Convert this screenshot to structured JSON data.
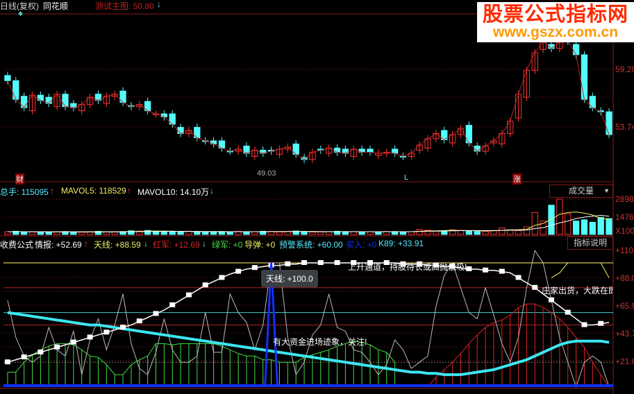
{
  "header": {
    "period_label": "日线(复权)",
    "app_name": "同花顺",
    "main_indicator": "测试主图: 50.80",
    "main_indicator_arrow": "↓"
  },
  "watermark": {
    "title": "股票公式指标网",
    "url": "www.gszx.com.cn"
  },
  "price_axis": [
    "59.29",
    "53.74"
  ],
  "price_annotations": {
    "low_label": "49.03",
    "finance_badge": "财",
    "limit_badge": "涨",
    "l_marker": "L"
  },
  "volume_header": {
    "total": "总手: 115095",
    "total_arrow": "↑",
    "mavol5": "MAVOL5: 118529",
    "mavol5_arrow": "↑",
    "mavol10": "MAVOL10: 14.10万",
    "mavol10_arrow": "↓",
    "selector": "成交量",
    "selector_arrow": "▼"
  },
  "volume_axis": [
    "2898",
    "1476",
    "X100"
  ],
  "indicator_header": {
    "name": "收费公式",
    "qingbao": "情报: +52.69",
    "qingbao_arrow": "↑",
    "tianxian": "天线: +88.59",
    "tianxian_arrow": "↓",
    "hongjun": "红军: +12.69",
    "hongjun_arrow": "↓",
    "lvjun": "绿军: +0",
    "daodan": "导弹: +0",
    "yujing": "预警系统: +60.00",
    "mairu": "买入: +0",
    "k89": "K89: +33.91",
    "help_button": "指标说明"
  },
  "indicator_axis": [
    "+110",
    "+88.0",
    "+65.9",
    "+43.7",
    "+21.6"
  ],
  "indicator_annotations": {
    "tooltip": "天线: +100.0",
    "uptrend": "上升通道，持股待长或高抛低吸!",
    "inflow": "有大资金进场迹象，关注!",
    "distribution": "庄家出货，大跌在即"
  },
  "colors": {
    "up": "#ff3333",
    "down": "#54fcfc",
    "grid": "#8b1a1a",
    "white_line": "#ffffff",
    "cyan_line": "#3ce6f0",
    "green_hist": "#44dd44",
    "red_hist": "#dd2222",
    "blue": "#1030ff",
    "yellow": "#f0f060"
  },
  "chart_data": {
    "type": "candlestick",
    "close": [
      58.2,
      56.4,
      55.6,
      56.8,
      56.3,
      56.0,
      56.9,
      55.7,
      55.6,
      55.9,
      56.6,
      56.3,
      56.7,
      56.9,
      56.1,
      55.7,
      55.9,
      55.3,
      55.0,
      54.7,
      54.0,
      53.1,
      53.4,
      52.7,
      52.4,
      52.1,
      51.7,
      51.4,
      51.6,
      51.2,
      51.5,
      51.2,
      51.4,
      51.6,
      51.8,
      51.1,
      50.6,
      51.3,
      51.5,
      51.7,
      51.3,
      51.2,
      51.6,
      51.3,
      51.3,
      51.2,
      51.3,
      51.2,
      50.9,
      51.2,
      52.0,
      52.6,
      53.1,
      52.5,
      53.0,
      53.6,
      52.2,
      51.4,
      51.9,
      52.4,
      53.1,
      54.3,
      56.9,
      59.2,
      60.9,
      62.0,
      61.3,
      61.9,
      62.0,
      60.7,
      56.4,
      55.6,
      55.2,
      53.0
    ],
    "volume": [
      230,
      260,
      190,
      200,
      210,
      180,
      220,
      240,
      200,
      190,
      230,
      260,
      210,
      200,
      240,
      300,
      280,
      330,
      270,
      250,
      230,
      210,
      260,
      230,
      210,
      220,
      240,
      200,
      260,
      230,
      220,
      260,
      250,
      210,
      240,
      280,
      230,
      190,
      200,
      220,
      260,
      240,
      230,
      210,
      220,
      200,
      250,
      240,
      200,
      230,
      420,
      350,
      280,
      300,
      380,
      340,
      290,
      240,
      250,
      330,
      540,
      380,
      320,
      620,
      1800,
      1100,
      2400,
      2898,
      1700,
      1100,
      1200,
      1000,
      1400,
      1300
    ],
    "mavol5": [
      230,
      230,
      230,
      230,
      220,
      210,
      210,
      210,
      210,
      210,
      215,
      220,
      220,
      220,
      230,
      240,
      250,
      270,
      280,
      280,
      270,
      250,
      240,
      235,
      230,
      225,
      220,
      220,
      225,
      230,
      230,
      235,
      235,
      235,
      240,
      245,
      245,
      240,
      230,
      225,
      225,
      230,
      235,
      230,
      225,
      220,
      225,
      230,
      230,
      230,
      260,
      290,
      300,
      320,
      340,
      330,
      320,
      300,
      290,
      300,
      350,
      380,
      390,
      420,
      740,
      900,
      1250,
      1650,
      1800,
      1840,
      1750,
      1600,
      1300,
      1250
    ],
    "mavol10": [
      230,
      230,
      230,
      230,
      225,
      220,
      220,
      220,
      220,
      215,
      215,
      215,
      215,
      215,
      220,
      225,
      230,
      240,
      245,
      250,
      255,
      255,
      255,
      250,
      245,
      240,
      235,
      230,
      228,
      228,
      228,
      230,
      232,
      234,
      236,
      238,
      240,
      238,
      235,
      232,
      230,
      230,
      230,
      230,
      230,
      228,
      228,
      230,
      230,
      230,
      245,
      260,
      270,
      285,
      300,
      315,
      320,
      320,
      320,
      320,
      335,
      345,
      350,
      360,
      480,
      560,
      750,
      950,
      1100,
      1300,
      1420,
      1500,
      1560,
      1500
    ],
    "indicator": {
      "qingbao": [
        20,
        22,
        24,
        26,
        28,
        30,
        32,
        34,
        36,
        38,
        40,
        42,
        44,
        46,
        48,
        50,
        53,
        56,
        59,
        62,
        66,
        70,
        74,
        78,
        82,
        85,
        88,
        91,
        93,
        95,
        96,
        97,
        98,
        98,
        99,
        99,
        100,
        100,
        100,
        100,
        100,
        100,
        100,
        100,
        100,
        100,
        100,
        100,
        99,
        99,
        99,
        98,
        98,
        97,
        97,
        96,
        95,
        95,
        94,
        94,
        93,
        92,
        88,
        84,
        80,
        75,
        70,
        65,
        60,
        55,
        50,
        50,
        51,
        52
      ],
      "k89": [
        60,
        59,
        58,
        57,
        56,
        55,
        54,
        53,
        52,
        51,
        50,
        50,
        49,
        48,
        47,
        46,
        45,
        44,
        43,
        42,
        41,
        40,
        39,
        38,
        37,
        36,
        35,
        34,
        33,
        32,
        31,
        30,
        29,
        28,
        27,
        26,
        25,
        24,
        23,
        22,
        21,
        20,
        19,
        18,
        17,
        16,
        15,
        14,
        13,
        12,
        12,
        11,
        11,
        10,
        10,
        10,
        11,
        12,
        13,
        14,
        16,
        18,
        20,
        22,
        25,
        28,
        31,
        34,
        36,
        37,
        37,
        37,
        37,
        36
      ],
      "gray": [
        70,
        40,
        25,
        20,
        25,
        48,
        30,
        25,
        45,
        10,
        38,
        55,
        30,
        50,
        75,
        35,
        15,
        10,
        28,
        55,
        30,
        20,
        20,
        25,
        60,
        28,
        28,
        75,
        60,
        52,
        30,
        50,
        100,
        100,
        40,
        10,
        20,
        42,
        50,
        75,
        48,
        45,
        30,
        28,
        20,
        10,
        18,
        38,
        30,
        15,
        20,
        25,
        65,
        90,
        100,
        80,
        60,
        55,
        80,
        58,
        35,
        20,
        40,
        80,
        110,
        100,
        70,
        40,
        20,
        0,
        20,
        25,
        20,
        0
      ],
      "green": [
        12,
        12,
        20,
        26,
        30,
        33,
        35,
        35,
        34,
        30,
        25,
        24,
        18,
        10,
        10,
        18,
        22,
        25,
        35,
        35,
        34,
        35,
        35,
        35,
        35,
        35,
        33,
        30,
        27,
        25,
        25,
        22,
        22,
        20,
        20,
        20,
        24,
        26,
        28,
        30,
        33,
        35,
        37,
        36,
        34,
        30,
        28,
        20,
        0,
        0,
        0,
        0,
        0,
        0,
        0,
        0,
        0,
        0,
        0,
        0,
        0,
        0,
        0,
        0,
        0,
        0,
        0,
        0,
        0,
        0,
        0,
        0,
        0,
        0
      ],
      "red": [
        0,
        0,
        0,
        0,
        0,
        0,
        0,
        0,
        0,
        0,
        0,
        0,
        0,
        0,
        0,
        0,
        0,
        0,
        0,
        0,
        0,
        0,
        0,
        0,
        0,
        0,
        0,
        0,
        0,
        0,
        0,
        0,
        0,
        0,
        0,
        0,
        0,
        0,
        0,
        0,
        0,
        0,
        0,
        0,
        0,
        0,
        0,
        0,
        0,
        0,
        0,
        0,
        8,
        14,
        20,
        27,
        35,
        42,
        48,
        52,
        54,
        58,
        64,
        67,
        67,
        64,
        60,
        55,
        48,
        40,
        32,
        20,
        10,
        0
      ],
      "yellow_start": 66,
      "yellow": [
        88,
        92,
        100,
        100,
        100,
        100,
        100,
        88
      ],
      "spike_index": 32,
      "spike_value": 100,
      "hlines": [
        {
          "v": 100,
          "c": "yellow"
        },
        {
          "v": 80,
          "c": "red"
        },
        {
          "v": 60,
          "c": "cyan"
        },
        {
          "v": 50,
          "c": "red"
        },
        {
          "v": 20,
          "c": "gray"
        }
      ]
    }
  }
}
